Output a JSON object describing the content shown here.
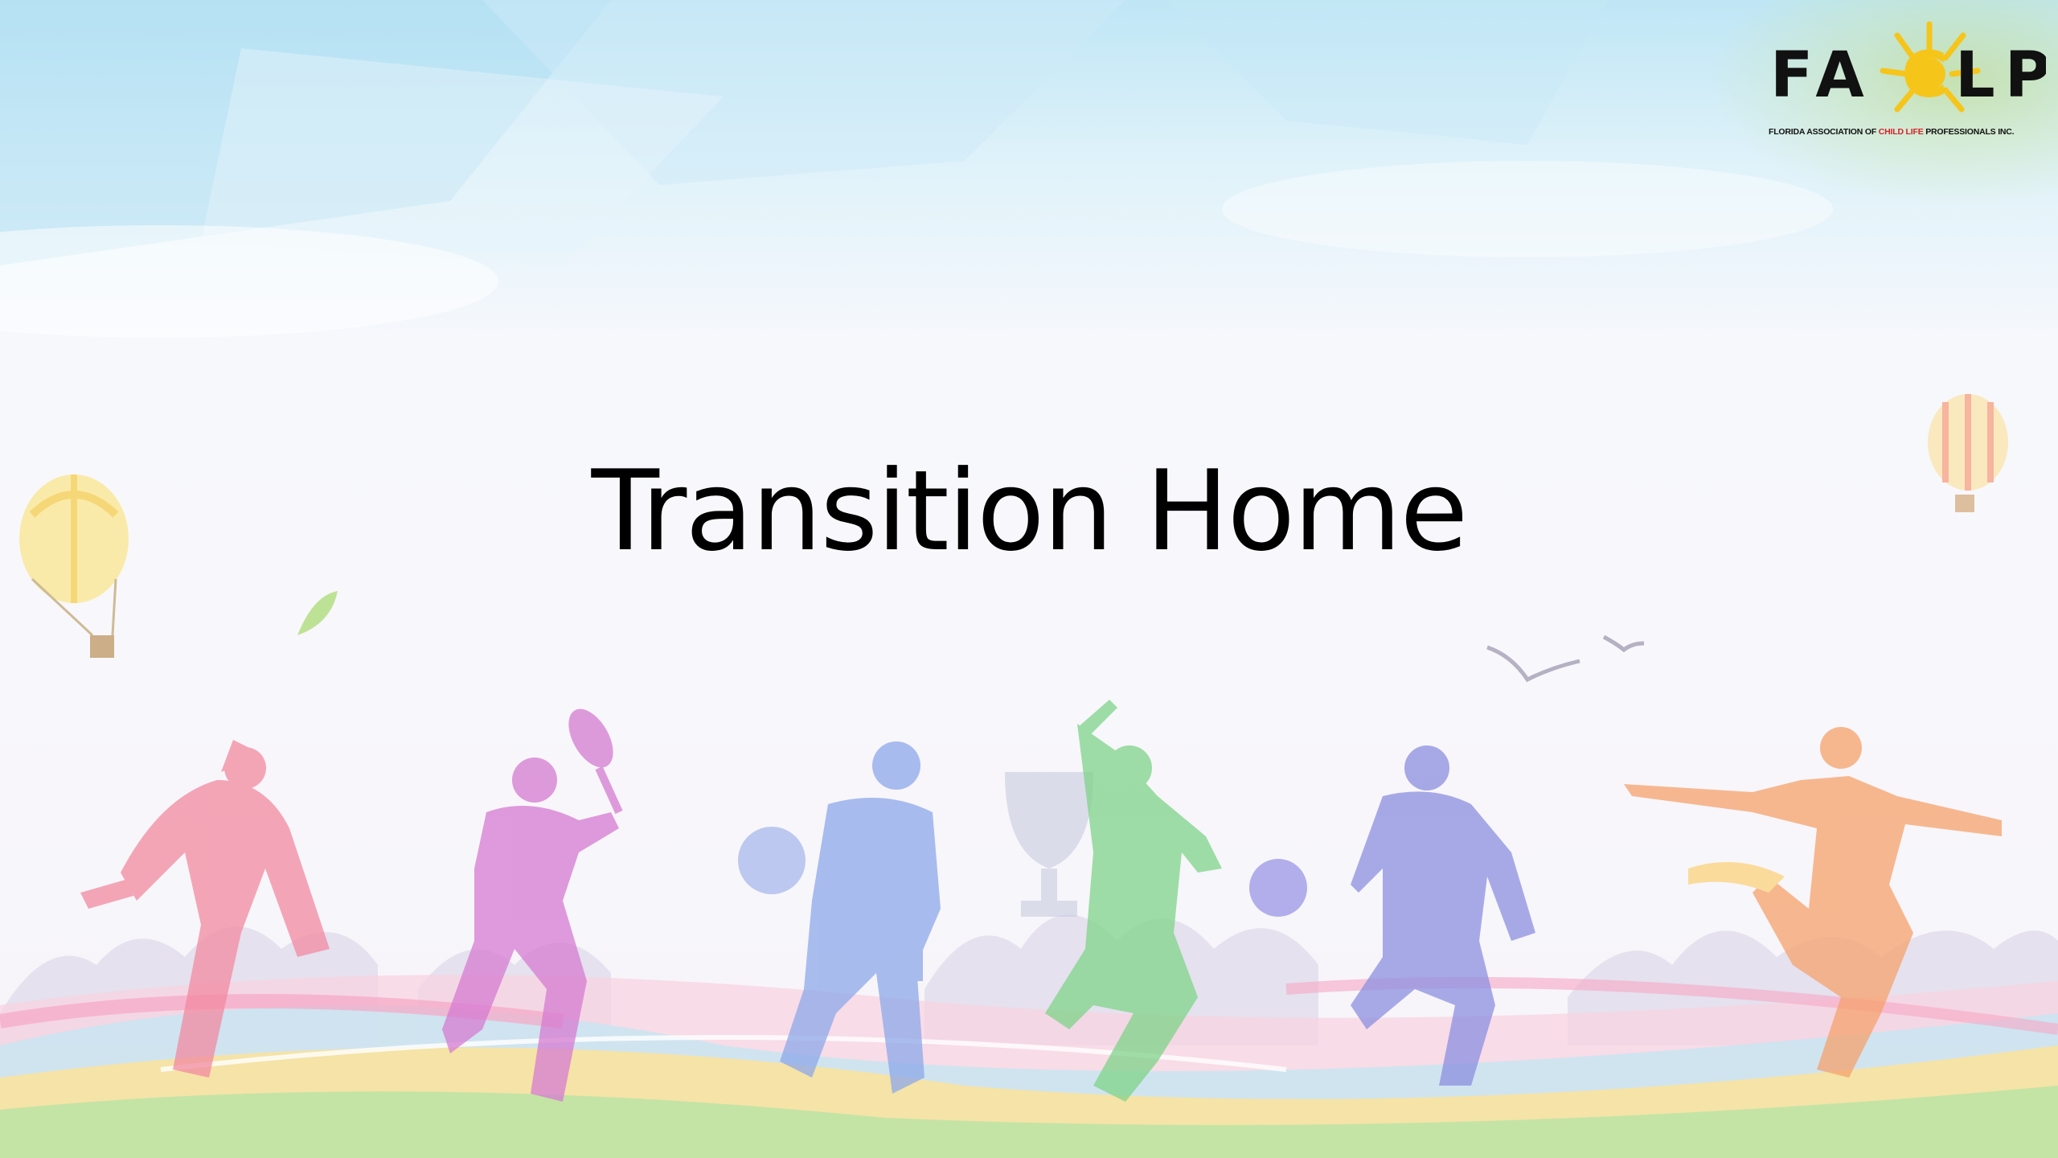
{
  "slide": {
    "title": "Transition Home"
  },
  "logo": {
    "letters_left": "FA",
    "letters_right": "LP",
    "tagline_before": "FLORIDA ASSOCIATION OF ",
    "tagline_highlight": "CHILD LIFE",
    "tagline_after": " PROFESSIONALS INC."
  },
  "colors": {
    "title": "#000000",
    "logo_text": "#111111",
    "logo_sun": "#f6c51a",
    "logo_highlight": "#d8202a"
  }
}
